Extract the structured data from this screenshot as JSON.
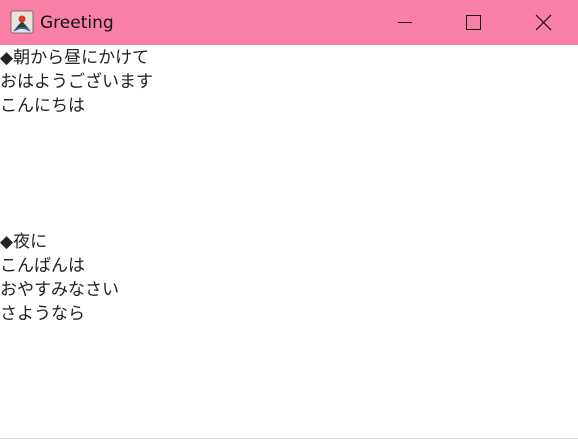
{
  "window": {
    "title": "Greeting",
    "titlebar_color": "#f97fa6",
    "controls": [
      "minimize-icon",
      "maximize-icon",
      "close-icon"
    ]
  },
  "content": {
    "morning_heading": "◆朝から昼にかけて",
    "morning_greetings": [
      "おはようございます",
      "こんにちは"
    ],
    "night_heading": "◆夜に",
    "night_greetings": [
      "こんばんは",
      "おやすみなさい",
      "さようなら"
    ]
  }
}
